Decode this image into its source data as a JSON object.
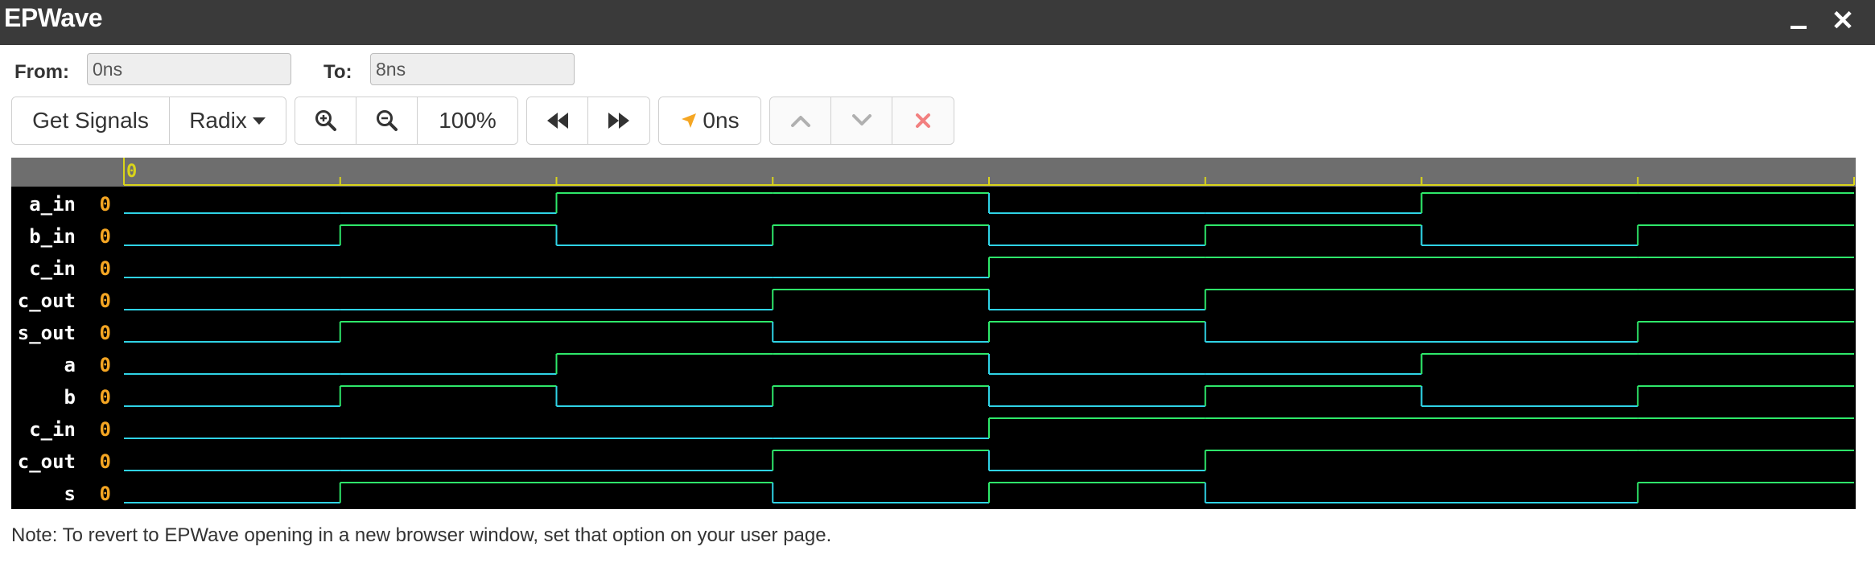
{
  "window": {
    "title": "EPWave",
    "minimize_icon": "minimize-icon",
    "close_glyph": "✕"
  },
  "range": {
    "from_label": "From:",
    "from_value": "0ns",
    "to_label": "To:",
    "to_value": "8ns"
  },
  "toolbar": {
    "get_signals_label": "Get Signals",
    "radix_label": "Radix",
    "zoom_in_icon": "zoom-in-icon",
    "zoom_out_icon": "zoom-out-icon",
    "zoom_level": "100%",
    "rewind_icon": "fast-backward-icon",
    "forward_icon": "fast-forward-icon",
    "cursor_icon": "cursor-arrow-icon",
    "cursor_time": "0ns",
    "up_icon": "chevron-up-icon",
    "down_icon": "chevron-down-icon",
    "remove_icon": "remove-icon"
  },
  "wave": {
    "timeline_cursor_label": "0",
    "time_range_ns": [
      0,
      8
    ],
    "colors": {
      "low": "#2fd3e6",
      "high": "#2ee86a",
      "value": "#f5a623",
      "timeline": "#d9d41a"
    },
    "signals": [
      {
        "name": "a_in",
        "value": "0",
        "levels": [
          0,
          0,
          1,
          1,
          0,
          0,
          1,
          1
        ]
      },
      {
        "name": "b_in",
        "value": "0",
        "levels": [
          0,
          1,
          0,
          1,
          0,
          1,
          0,
          1
        ]
      },
      {
        "name": "c_in",
        "value": "0",
        "levels": [
          0,
          0,
          0,
          0,
          1,
          1,
          1,
          1
        ]
      },
      {
        "name": "c_out",
        "value": "0",
        "levels": [
          0,
          0,
          0,
          1,
          0,
          1,
          1,
          1
        ]
      },
      {
        "name": "s_out",
        "value": "0",
        "levels": [
          0,
          1,
          1,
          0,
          1,
          0,
          0,
          1
        ]
      },
      {
        "name": "a",
        "value": "0",
        "levels": [
          0,
          0,
          1,
          1,
          0,
          0,
          1,
          1
        ]
      },
      {
        "name": "b",
        "value": "0",
        "levels": [
          0,
          1,
          0,
          1,
          0,
          1,
          0,
          1
        ]
      },
      {
        "name": "c_in",
        "value": "0",
        "levels": [
          0,
          0,
          0,
          0,
          1,
          1,
          1,
          1
        ]
      },
      {
        "name": "c_out",
        "value": "0",
        "levels": [
          0,
          0,
          0,
          1,
          0,
          1,
          1,
          1
        ]
      },
      {
        "name": "s",
        "value": "0",
        "levels": [
          0,
          1,
          1,
          0,
          1,
          0,
          0,
          1
        ]
      }
    ]
  },
  "footer": {
    "note": "Note: To revert to EPWave opening in a new browser window, set that option on your user page."
  }
}
